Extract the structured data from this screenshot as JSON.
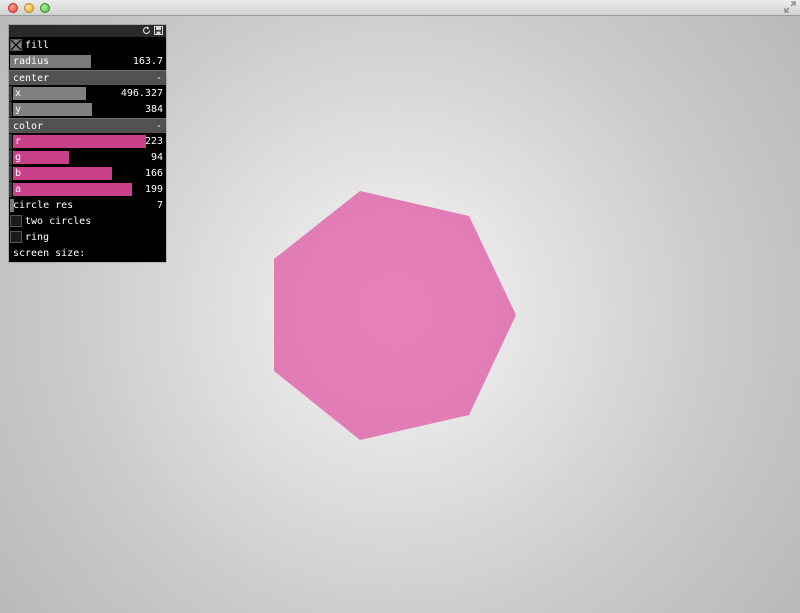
{
  "window": {
    "controls": [
      "close",
      "minimize",
      "zoom"
    ],
    "fullscreen_icon": "fullscreen-arrows-icon"
  },
  "panel": {
    "header_icons": [
      "refresh-icon",
      "save-icon"
    ],
    "fill": {
      "label": "fill",
      "checked": true
    },
    "radius": {
      "label": "radius",
      "value": "163.7",
      "fraction": 0.52
    },
    "center": {
      "label": "center",
      "collapse": "-",
      "x": {
        "label": "x",
        "value": "496.327",
        "fraction": 0.48
      },
      "y": {
        "label": "y",
        "value": "384",
        "fraction": 0.52
      }
    },
    "color": {
      "label": "color",
      "collapse": "-",
      "r": {
        "label": "r",
        "value": "223",
        "fraction": 0.875
      },
      "g": {
        "label": "g",
        "value": "94",
        "fraction": 0.369
      },
      "b": {
        "label": "b",
        "value": "166",
        "fraction": 0.651
      },
      "a": {
        "label": "a",
        "value": "199",
        "fraction": 0.78
      }
    },
    "circle_res": {
      "label": "circle res",
      "value": "7"
    },
    "two_circles": {
      "label": "two circles",
      "checked": false
    },
    "ring": {
      "label": "ring",
      "checked": false
    },
    "screen_size": {
      "label": "screen size:"
    }
  },
  "shape": {
    "type": "heptagon",
    "fill_color": "#df5ea6",
    "opacity": 0.78
  }
}
